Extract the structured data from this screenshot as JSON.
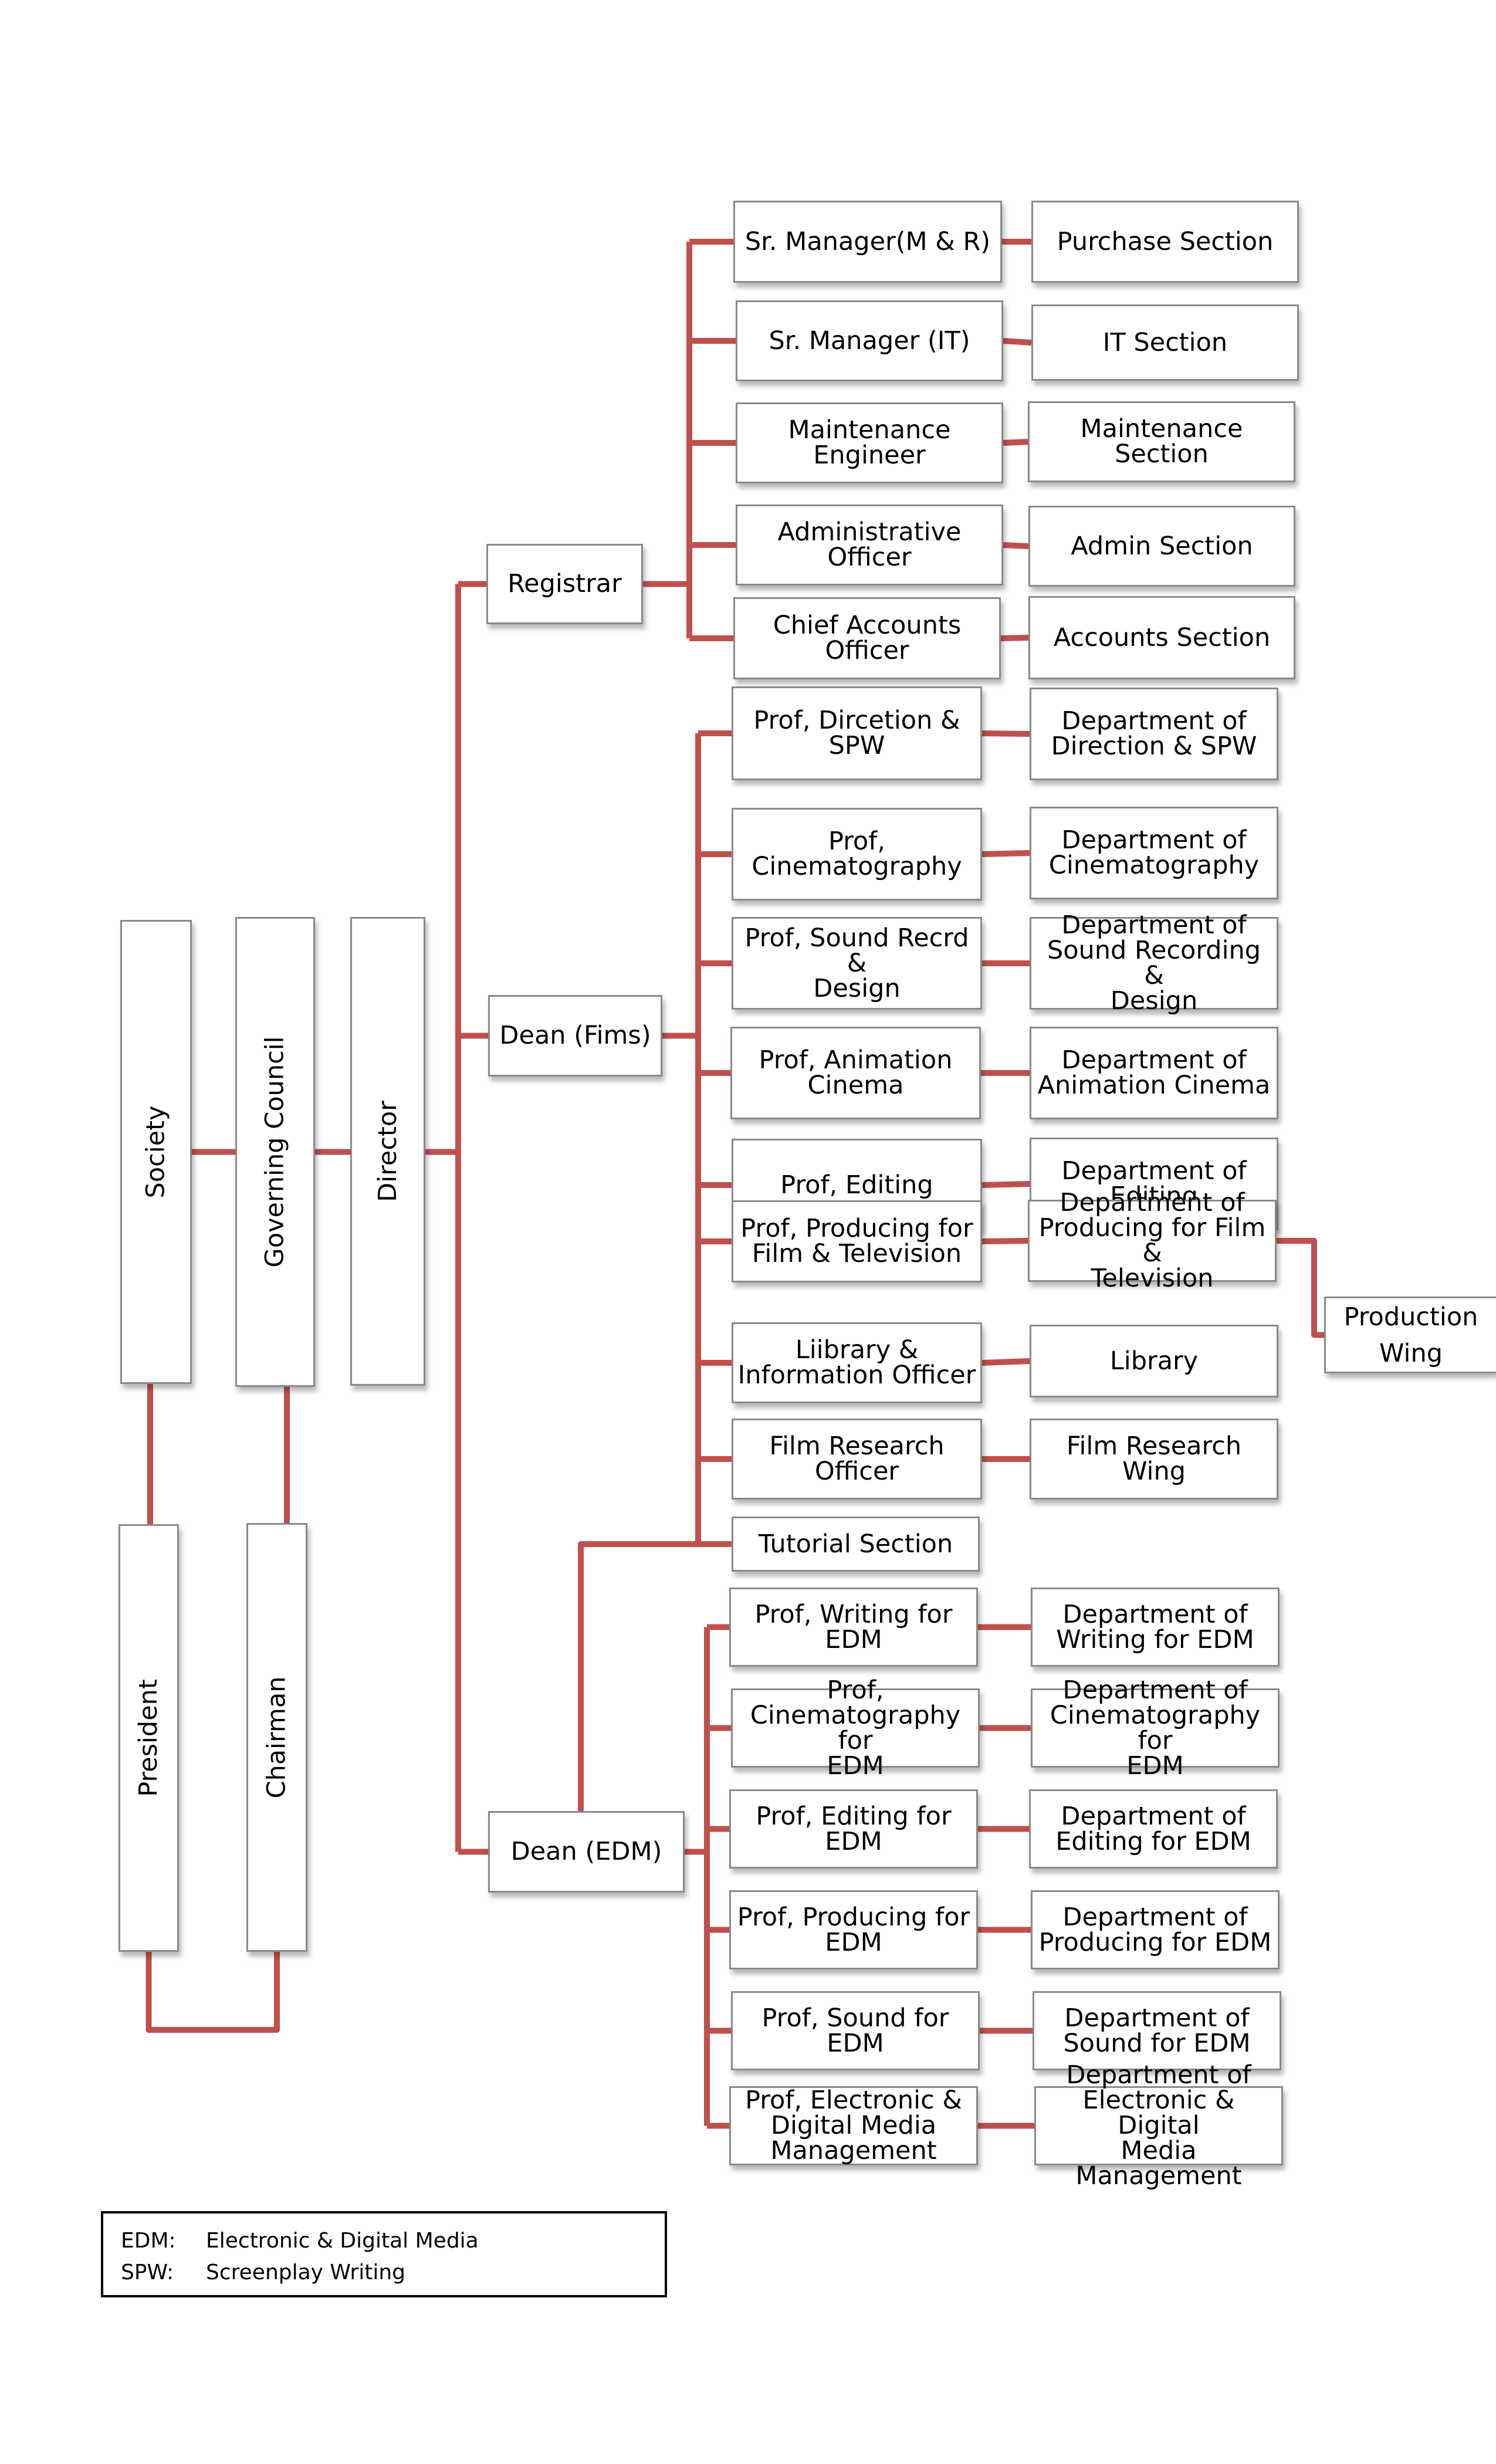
{
  "diagram": {
    "type": "organization-chart",
    "connector_color": "#C0504D",
    "top_chain": {
      "society": "Society",
      "governing_council": "Governing Council",
      "director": "Director"
    },
    "heads": {
      "president": "President",
      "chairman": "Chairman"
    },
    "branches": {
      "registrar": {
        "label": "Registrar",
        "rows": [
          {
            "officer": "Sr. Manager(M & R)",
            "unit": "Purchase Section"
          },
          {
            "officer": "Sr. Manager (IT)",
            "unit": "IT Section"
          },
          {
            "officer": "Maintenance\nEngineer",
            "unit": "Maintenance Section"
          },
          {
            "officer": "Administrative\nOfficer",
            "unit": "Admin Section"
          },
          {
            "officer": "Chief Accounts\nOfficer",
            "unit": "Accounts Section"
          }
        ]
      },
      "dean_fims": {
        "label": "Dean (Fims)",
        "rows": [
          {
            "officer": "Prof, Dircetion &\nSPW",
            "unit": "Department of\nDirection & SPW"
          },
          {
            "officer": "Prof,\nCinematography",
            "unit": "Department of\nCinematography"
          },
          {
            "officer": "Prof, Sound Recrd &\nDesign",
            "unit": "Department of\nSound Recording &\nDesign"
          },
          {
            "officer": "Prof, Animation\nCinema",
            "unit": "Department of\nAnimation Cinema"
          },
          {
            "officer": "Prof, Editing",
            "unit": "Department of\nEditing"
          },
          {
            "officer": "Prof, Producing for\nFilm & Television",
            "unit": "Department of\nProducing for Film &\nTelevision",
            "sub_unit": "Production\nWing"
          },
          {
            "officer": "Liibrary &\nInformation Officer",
            "unit": "Library"
          },
          {
            "officer": "Film Research Officer",
            "unit": "Film Research Wing"
          },
          {
            "officer": "Tutorial Section"
          }
        ]
      },
      "dean_edm": {
        "label": "Dean (EDM)",
        "rows": [
          {
            "officer": "Prof, Writing for EDM",
            "unit": "Department of\nWriting for EDM"
          },
          {
            "officer": "Prof,\nCinematography for\nEDM",
            "unit": "Department of\nCinematography for\nEDM"
          },
          {
            "officer": "Prof, Editing for EDM",
            "unit": "Department of\nEditing for EDM"
          },
          {
            "officer": "Prof, Producing for\nEDM",
            "unit": "Department of\nProducing for EDM"
          },
          {
            "officer": "Prof, Sound for EDM",
            "unit": "Department of\nSound for EDM"
          },
          {
            "officer": "Prof, Electronic &\nDigital Media\nManagement",
            "unit": "Department of\nElectronic & Digital\nMedia Management"
          }
        ]
      }
    },
    "legend": [
      {
        "abbr": "EDM:",
        "meaning": "Electronic & Digital Media"
      },
      {
        "abbr": "SPW:",
        "meaning": "Screenplay Writing"
      }
    ]
  }
}
